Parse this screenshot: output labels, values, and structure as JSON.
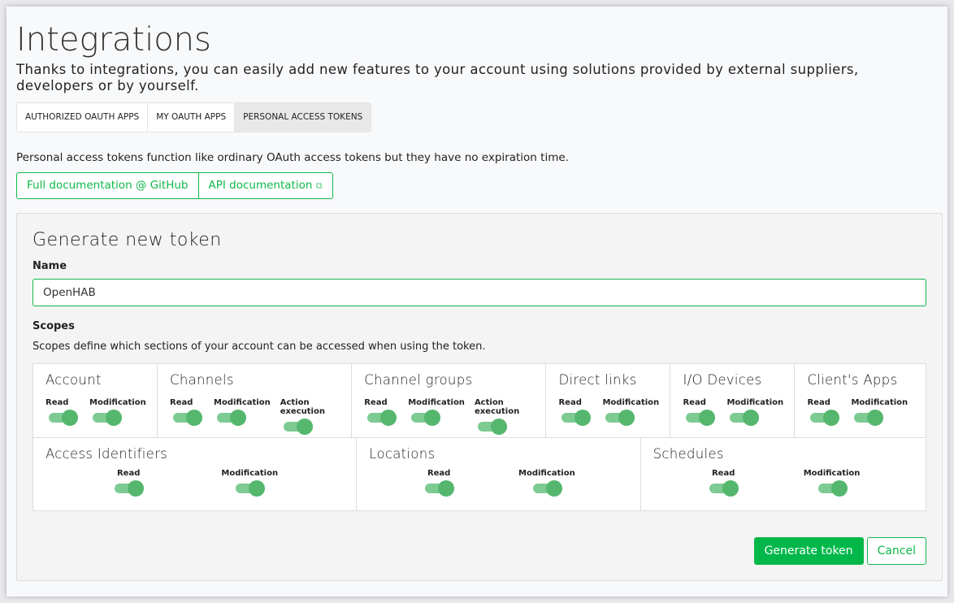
{
  "page": {
    "title": "Integrations",
    "lead": "Thanks to integrations, you can easily add new features to your account using solutions provided by external suppliers, developers or by yourself."
  },
  "tabs": [
    {
      "label": "AUTHORIZED OAUTH APPS",
      "active": false
    },
    {
      "label": "MY OAUTH APPS",
      "active": false
    },
    {
      "label": "PERSONAL ACCESS TOKENS",
      "active": true
    }
  ],
  "description": "Personal access tokens function like ordinary OAuth access tokens but they have no expiration time.",
  "links": {
    "github": "Full documentation @ GitHub",
    "api": "API documentation",
    "api_icon": "external-link-icon"
  },
  "form": {
    "heading": "Generate new token",
    "name_label": "Name",
    "name_value": "OpenHAB",
    "scopes_label": "Scopes",
    "scopes_desc": "Scopes define which sections of your account can be accessed when using the token.",
    "rows": [
      [
        {
          "name": "Account",
          "perms": [
            {
              "label": "Read",
              "on": true
            },
            {
              "label": "Modification",
              "on": true
            }
          ]
        },
        {
          "name": "Channels",
          "perms": [
            {
              "label": "Read",
              "on": true
            },
            {
              "label": "Modification",
              "on": true
            },
            {
              "label": "Action execution",
              "on": true
            }
          ]
        },
        {
          "name": "Channel groups",
          "perms": [
            {
              "label": "Read",
              "on": true
            },
            {
              "label": "Modification",
              "on": true
            },
            {
              "label": "Action execution",
              "on": true
            }
          ]
        },
        {
          "name": "Direct links",
          "perms": [
            {
              "label": "Read",
              "on": true
            },
            {
              "label": "Modification",
              "on": true
            }
          ]
        },
        {
          "name": "I/O Devices",
          "perms": [
            {
              "label": "Read",
              "on": true
            },
            {
              "label": "Modification",
              "on": true
            }
          ]
        },
        {
          "name": "Client's Apps",
          "perms": [
            {
              "label": "Read",
              "on": true
            },
            {
              "label": "Modification",
              "on": true
            }
          ]
        }
      ],
      [
        {
          "name": "Access Identifiers",
          "perms": [
            {
              "label": "Read",
              "on": true
            },
            {
              "label": "Modification",
              "on": true
            }
          ]
        },
        {
          "name": "Locations",
          "perms": [
            {
              "label": "Read",
              "on": true
            },
            {
              "label": "Modification",
              "on": true
            }
          ]
        },
        {
          "name": "Schedules",
          "perms": [
            {
              "label": "Read",
              "on": true
            },
            {
              "label": "Modification",
              "on": true
            }
          ]
        }
      ]
    ],
    "generate": "Generate token",
    "cancel": "Cancel"
  },
  "colors": {
    "accent": "#00b84a",
    "toggle_track": "#7dcb92",
    "toggle_knob": "#55b66e"
  }
}
